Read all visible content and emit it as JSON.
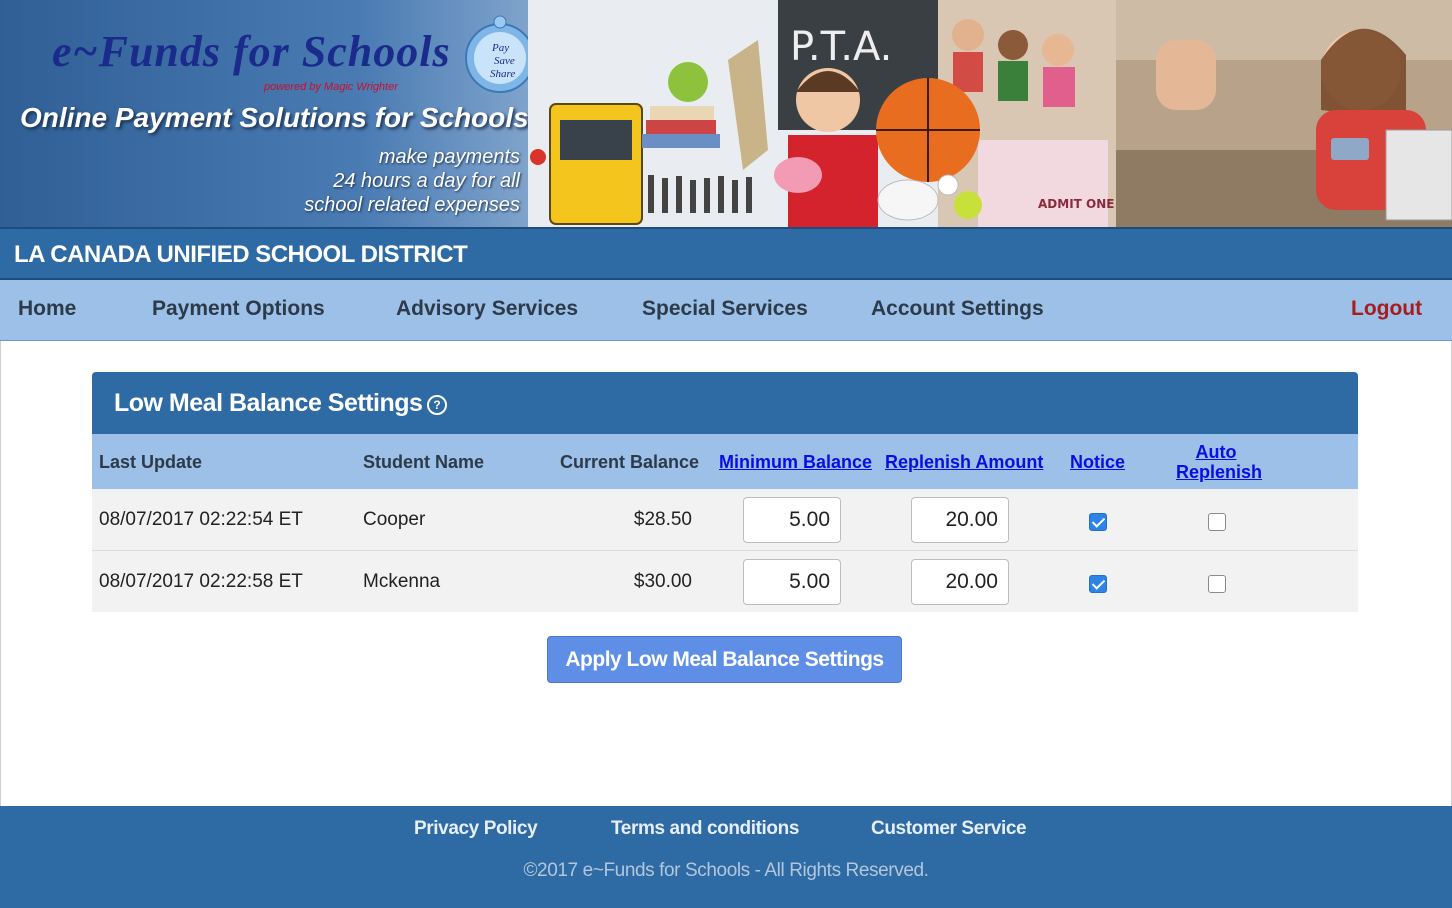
{
  "banner": {
    "brand": "e~Funds for Schools",
    "powered_by": "powered by Magic Wrighter",
    "logo_text": [
      "Pay",
      "Save",
      "Share"
    ],
    "tagline": "Online Payment Solutions for Schools",
    "sub_lines": [
      "make payments",
      "24 hours a day for all",
      "school related expenses"
    ],
    "collage_labels": [
      "P.T.A.",
      "ADMIT ONE"
    ]
  },
  "district": "LA CANADA UNIFIED SCHOOL DISTRICT",
  "nav": {
    "items": [
      "Home",
      "Payment Options",
      "Advisory Services",
      "Special Services",
      "Account Settings"
    ],
    "logout": "Logout"
  },
  "panel": {
    "title": "Low Meal Balance Settings",
    "help_glyph": "?",
    "columns": {
      "last_update": "Last Update",
      "student_name": "Student Name",
      "current_balance": "Current Balance",
      "minimum_balance": "Minimum Balance",
      "replenish_amount": "Replenish Amount",
      "notice": "Notice",
      "auto_replenish_1": "Auto",
      "auto_replenish_2": "Replenish"
    },
    "rows": [
      {
        "last_update": "08/07/2017 02:22:54 ET",
        "student": "Cooper",
        "balance": "$28.50",
        "minimum": "5.00",
        "replenish": "20.00",
        "notice": true,
        "auto": false
      },
      {
        "last_update": "08/07/2017 02:22:58 ET",
        "student": "Mckenna",
        "balance": "$30.00",
        "minimum": "5.00",
        "replenish": "20.00",
        "notice": true,
        "auto": false
      }
    ],
    "apply_label": "Apply Low Meal Balance Settings"
  },
  "footer": {
    "links": [
      "Privacy Policy",
      "Terms and conditions",
      "Customer Service"
    ],
    "copyright": "©2017 e~Funds for Schools - All Rights Reserved."
  },
  "colors": {
    "header_blue": "#2e6aa3",
    "nav_light_blue": "#9cc0e7",
    "button_blue": "#5f8ee6",
    "logout_red": "#a51d1d",
    "link_blue": "#0b0ee0"
  }
}
